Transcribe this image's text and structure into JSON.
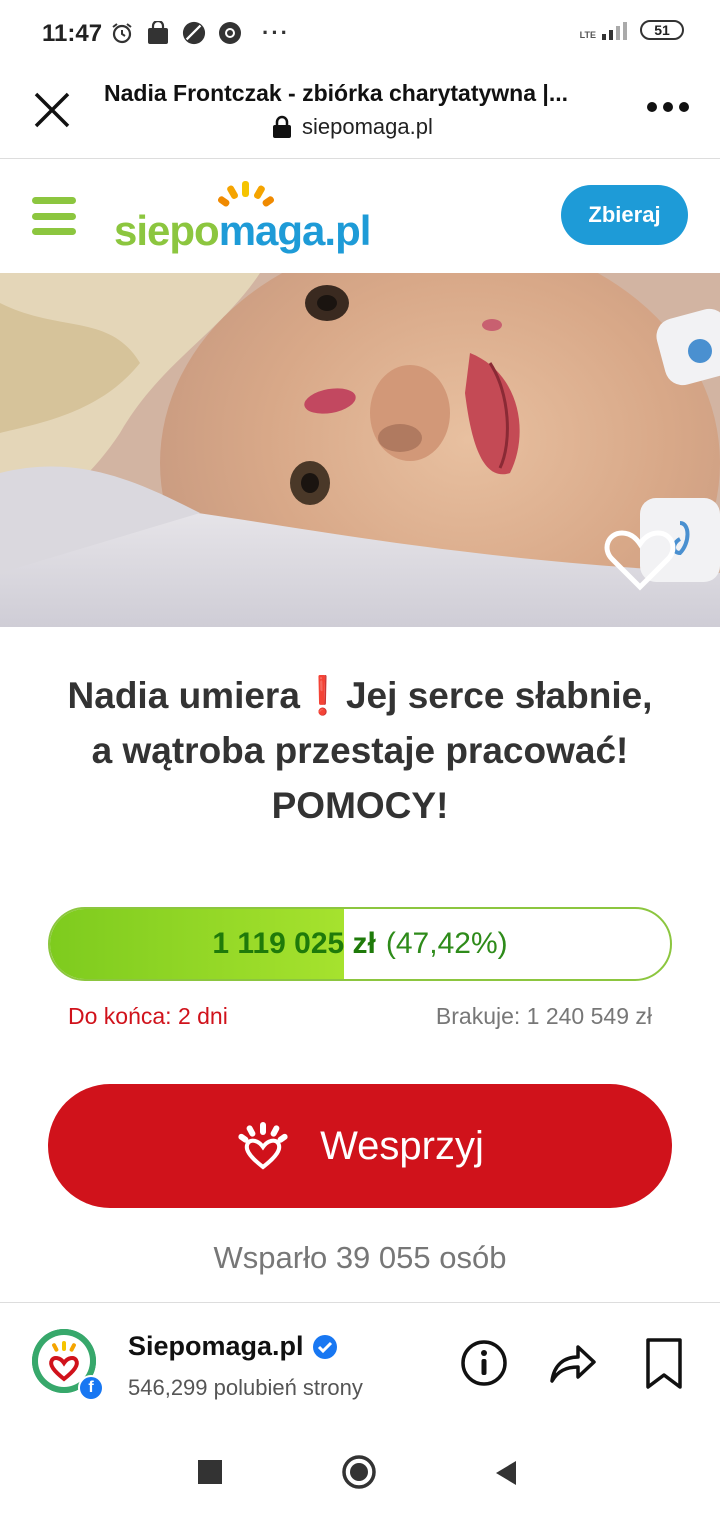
{
  "status_bar": {
    "time": "11:47",
    "network": "LTE",
    "battery": "51"
  },
  "browser": {
    "page_title": "Nadia Frontczak - zbiórka charytatywna |...",
    "url": "siepomaga.pl"
  },
  "site_header": {
    "logo_text_green": "siepo",
    "logo_text_blue": "maga.pl",
    "collect_button": "Zbieraj"
  },
  "campaign": {
    "headline_line1": "Nadia umiera",
    "headline_emoji": "❗",
    "headline_line1b": "Jej serce słabnie,",
    "headline_line2": "a wątroba przestaje pracować!",
    "headline_line3": "POMOCY!",
    "amount_raised": "1 119 025 zł",
    "percent_label": "(47,42%)",
    "progress_fraction": 0.4742,
    "deadline": "Do końca: 2 dni",
    "missing": "Brakuje: 1 240 549 zł",
    "donate_button": "Wesprzyj",
    "supporters": "Wsparło 39 055 osób"
  },
  "facebook_bar": {
    "page_name": "Siepomaga.pl",
    "likes": "546,299 polubień strony"
  },
  "colors": {
    "brand_green": "#8cc63f",
    "brand_blue": "#1e9bd7",
    "donate_red": "#d0121b"
  }
}
